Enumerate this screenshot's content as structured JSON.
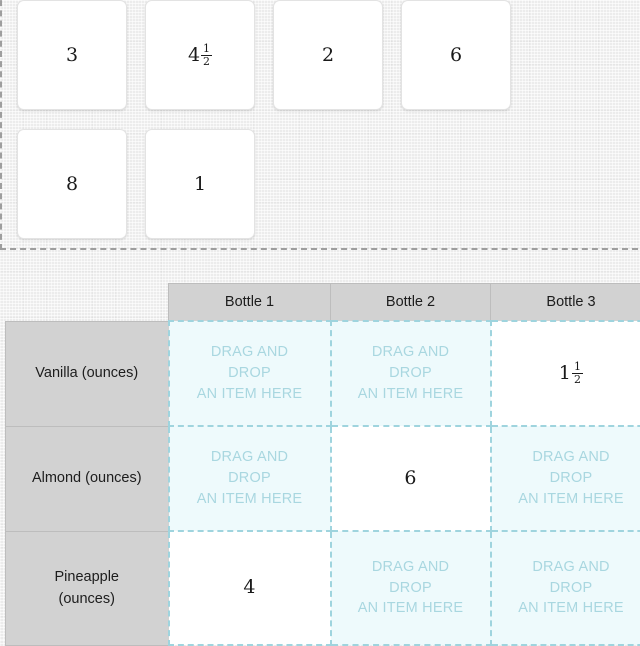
{
  "colors": {
    "page_background": "#f2f2f2",
    "tray_border": "#9e9e9e",
    "tile_background": "#ffffff",
    "header_background": "#d2d2d2",
    "dropzone_border": "#9fd4de",
    "dropzone_background": "#eefafc",
    "dropzone_text": "#a9d7e0",
    "value_text": "#1a1a1a"
  },
  "tray": {
    "name": "item-tray",
    "rows": [
      [
        {
          "display": "3",
          "whole": "3",
          "numerator": null,
          "denominator": null
        },
        {
          "display": "4 1/2",
          "whole": "4",
          "numerator": "1",
          "denominator": "2"
        },
        {
          "display": "2",
          "whole": "2",
          "numerator": null,
          "denominator": null
        },
        {
          "display": "6",
          "whole": "6",
          "numerator": null,
          "denominator": null
        }
      ],
      [
        {
          "display": "8",
          "whole": "8",
          "numerator": null,
          "denominator": null
        },
        {
          "display": "1",
          "whole": "1",
          "numerator": null,
          "denominator": null
        }
      ]
    ]
  },
  "table": {
    "corner_label": "",
    "column_headers": [
      "Bottle 1",
      "Bottle 2",
      "Bottle 3"
    ],
    "placeholder": {
      "line1": "DRAG AND",
      "line2": "DROP",
      "line3": "AN ITEM HERE"
    },
    "rows": [
      {
        "label": "Vanilla (ounces)",
        "label_lines": [
          "Vanilla (ounces)"
        ],
        "cells": [
          {
            "filled": false,
            "whole": null,
            "numerator": null,
            "denominator": null
          },
          {
            "filled": false,
            "whole": null,
            "numerator": null,
            "denominator": null
          },
          {
            "filled": true,
            "whole": "1",
            "numerator": "1",
            "denominator": "2"
          }
        ]
      },
      {
        "label": "Almond (ounces)",
        "label_lines": [
          "Almond (ounces)"
        ],
        "cells": [
          {
            "filled": false,
            "whole": null,
            "numerator": null,
            "denominator": null
          },
          {
            "filled": true,
            "whole": "6",
            "numerator": null,
            "denominator": null
          },
          {
            "filled": false,
            "whole": null,
            "numerator": null,
            "denominator": null
          }
        ]
      },
      {
        "label": "Pineapple (ounces)",
        "label_lines": [
          "Pineapple",
          "(ounces)"
        ],
        "cells": [
          {
            "filled": true,
            "whole": "4",
            "numerator": null,
            "denominator": null
          },
          {
            "filled": false,
            "whole": null,
            "numerator": null,
            "denominator": null
          },
          {
            "filled": false,
            "whole": null,
            "numerator": null,
            "denominator": null
          }
        ]
      }
    ]
  }
}
